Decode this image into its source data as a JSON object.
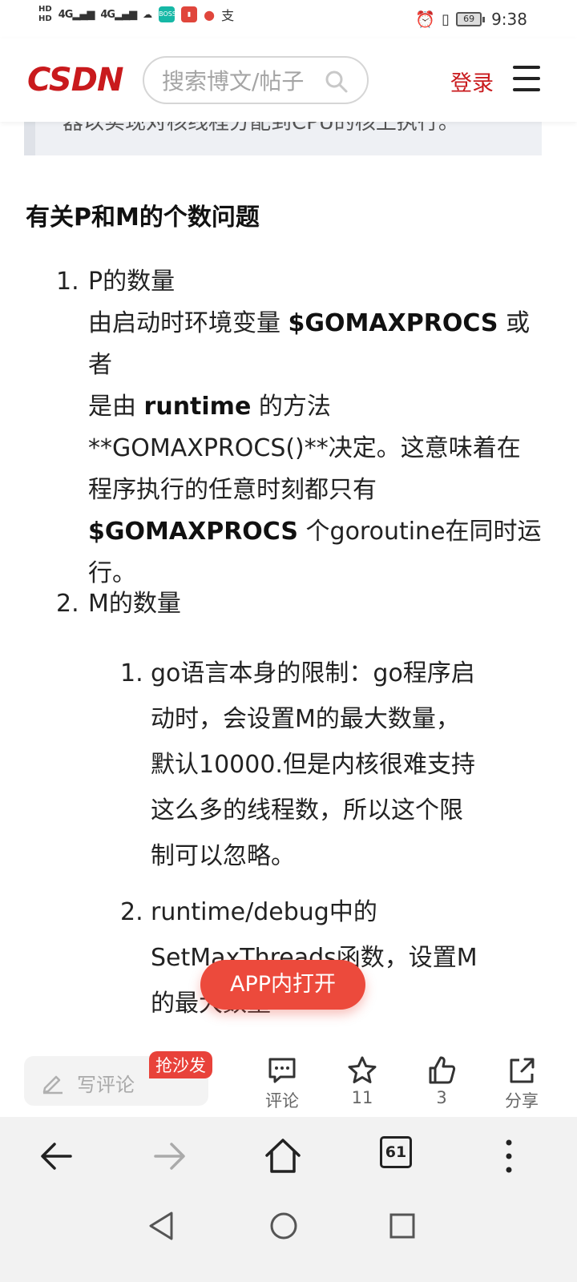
{
  "status_bar": {
    "time": "9:38",
    "battery": "69",
    "network_left": [
      "HD",
      "HD"
    ],
    "signal_labels": [
      "4G",
      "4G"
    ],
    "apps": [
      {
        "name": "boss-app",
        "label": "BOSS直聘",
        "color": "#16b8a6"
      },
      {
        "name": "reader-app",
        "label": "",
        "color": "#e0463c"
      },
      {
        "name": "map-app",
        "label": "",
        "color": "#e0463c"
      }
    ]
  },
  "header": {
    "logo": "CSDN",
    "search_placeholder": "搜索博文/帖子",
    "login_label": "登录"
  },
  "article": {
    "quote_tail": "器以实现对核线程分配到CPU的核上执行。",
    "section_title": "有关P和M的个数问题",
    "items": [
      {
        "number": "1.",
        "title": "P的数量",
        "lines": [
          {
            "segments": [
              {
                "t": "由启动时环境变量 ",
                "b": false
              },
              {
                "t": "$GOMAXPROCS",
                "b": true
              },
              {
                "t": " 或者",
                "b": false
              }
            ]
          },
          {
            "segments": [
              {
                "t": "是由 ",
                "b": false
              },
              {
                "t": "runtime",
                "b": true
              },
              {
                "t": " 的方法",
                "b": false
              }
            ]
          },
          {
            "segments": [
              {
                "t": "**GOMAXPROCS()**决定。这意味着在",
                "b": false
              }
            ]
          },
          {
            "segments": [
              {
                "t": "程序执行的任意时刻都只有",
                "b": false
              }
            ]
          },
          {
            "segments": [
              {
                "t": "$GOMAXPROCS",
                "b": true
              },
              {
                "t": " 个goroutine在同时运",
                "b": false
              }
            ]
          },
          {
            "segments": [
              {
                "t": "行。",
                "b": false
              }
            ]
          }
        ]
      },
      {
        "number": "2.",
        "title": "M的数量",
        "subitems": [
          {
            "number": "1.",
            "lines": [
              "go语言本身的限制：go程序启",
              "动时，会设置M的最大数量，",
              "默认10000.但是内核很难支持",
              "这么多的线程数，所以这个限",
              "制可以忽略。"
            ]
          },
          {
            "number": "2.",
            "lines": [
              "runtime/debug中的",
              "SetMaxThreads函数，设置M",
              "的最大数量"
            ]
          }
        ]
      }
    ]
  },
  "floating_button": {
    "label": "APP内打开"
  },
  "action_bar": {
    "comment_placeholder": "写评论",
    "sofa_badge": "抢沙发",
    "comment_label": "评论",
    "favorite_count": "11",
    "like_count": "3",
    "share_label": "分享"
  },
  "browser_nav": {
    "tab_count": "61"
  },
  "colors": {
    "brand_red": "#c91a1d",
    "float_red": "#ec4a3c"
  }
}
